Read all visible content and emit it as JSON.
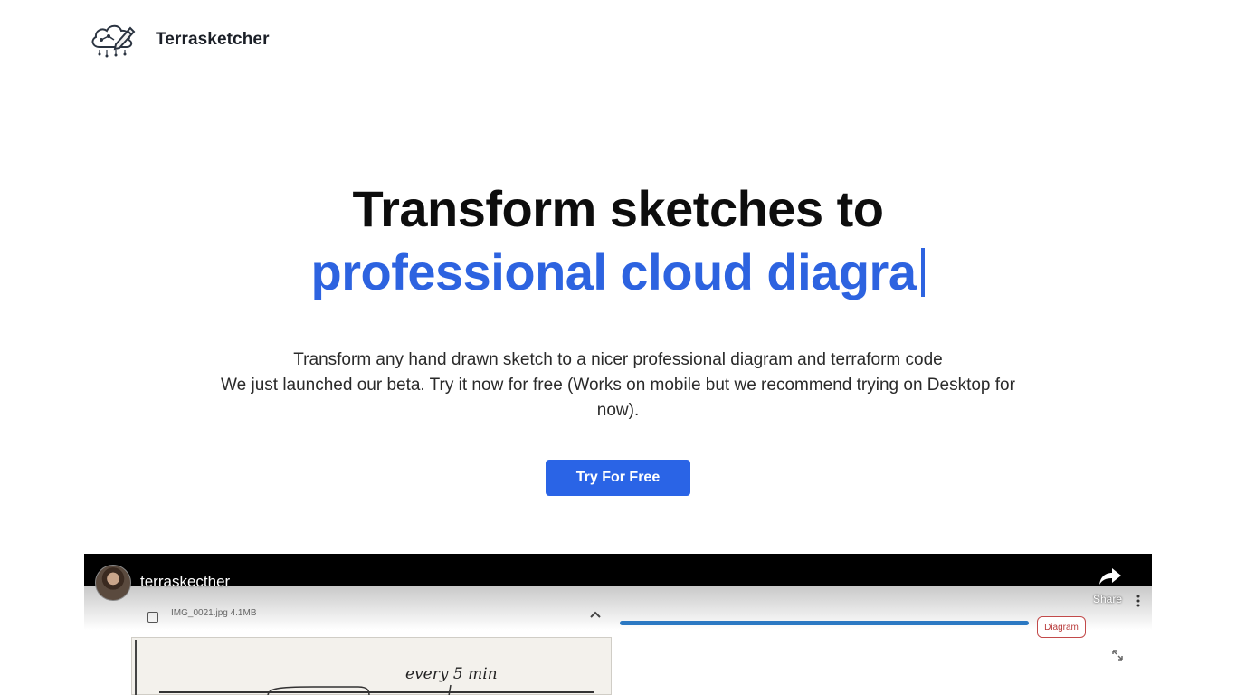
{
  "header": {
    "logo_icon": "cloud-pencil-logo-icon",
    "brand": "Terrasketcher"
  },
  "hero": {
    "line1": "Transform sketches to",
    "line2": "professional cloud diagra",
    "accent_color": "#2d63e0"
  },
  "subtitle": {
    "line1": "Transform any hand drawn sketch to a nicer professional diagram and terraform code",
    "line2": "We just launched our beta. Try it now for free (Works on mobile but we recommend trying on Desktop for now)."
  },
  "cta": {
    "label": "Try For Free",
    "color": "#2a64e6"
  },
  "video": {
    "channel": "terraskecther",
    "share_label": "Share",
    "file_name": "IMG_0021.jpg  4.1MB",
    "diagram_button": "Diagram",
    "sketch_text": "every 5 min",
    "icons": [
      "share-arrow-icon",
      "more-vertical-icon",
      "chevron-up-icon",
      "expand-icon",
      "checkbox-icon"
    ]
  }
}
